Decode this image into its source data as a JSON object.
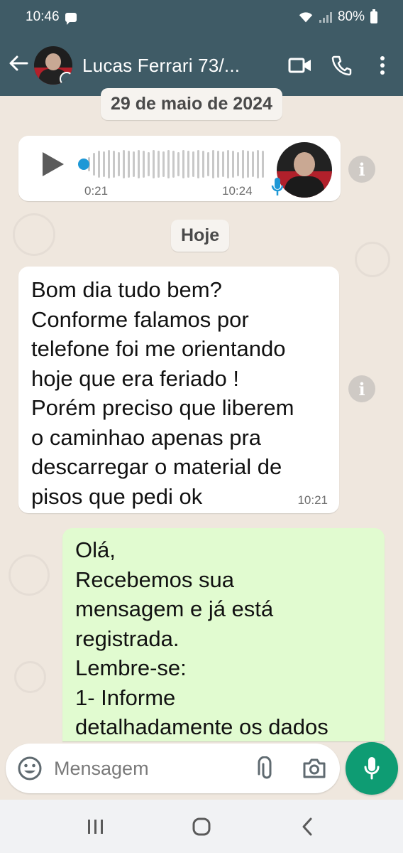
{
  "status_bar": {
    "time": "10:46",
    "battery": "80%"
  },
  "header": {
    "contact_name": "Lucas Ferrari 73/..."
  },
  "chat": {
    "date_chip": "29 de maio de 2024",
    "today_chip": "Hoje",
    "voice_message": {
      "duration": "0:21",
      "sent_time": "10:24"
    },
    "incoming_message": {
      "text": "Bom dia tudo bem?\nConforme falamos por\ntelefone foi me orientando\nhoje que era feriado !\nPorém preciso que liberem\no caminhao apenas pra\ndescarregar o material de\npisos que pedi ok",
      "time": "10:21"
    },
    "outgoing_message": {
      "text": "Olá,\nRecebemos sua\nmensagem e já está\nregistrada.\nLembre-se:\n1- Informe\ndetalhadamente os dados"
    }
  },
  "composer": {
    "placeholder": "Mensagem"
  },
  "colors": {
    "header": "#3f5b66",
    "accent": "#0e9c73",
    "outgoing_bubble": "#e1fbd0",
    "wallpaper": "#efe7de"
  }
}
